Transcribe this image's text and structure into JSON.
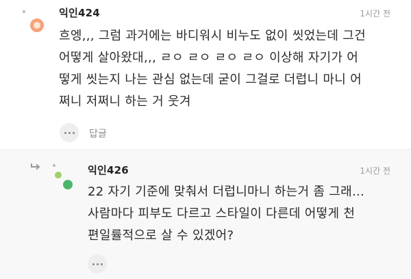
{
  "comments": [
    {
      "nickname": "익인424",
      "time": "1시간 전",
      "text": "흐엥,,, 그럼 과거에는 바디워시 비누도 없이 씻었는데 그건\n어떻게 살아왔대,,, ㄹㅇ ㄹㅇ ㄹㅇ ㄹㅇ 이상해 자기가 어\n떻게 씻는지 나는 관심 없는데 굳이 그걸로 더럽니 마니 어\n쩌니 저쩌니 하는 거 웃겨",
      "reply_label": "답글",
      "more_icon": "ellipsis-icon",
      "avatar_color": "#f5a37a"
    },
    {
      "nickname": "익인426",
      "time": "1시간 전",
      "text": "22 자기 기준에 맞춰서 더럽니마니 하는거 좀 그래...\n사람마다 피부도 다르고 스타일이 다른데 어떻게 천\n편일률적으로 살 수 있겠어?",
      "is_reply": true,
      "reply_icon": "reply-arrow-icon",
      "more_icon": "ellipsis-icon",
      "avatar_colors": [
        "#9fd06b",
        "#4cb56a"
      ]
    }
  ]
}
